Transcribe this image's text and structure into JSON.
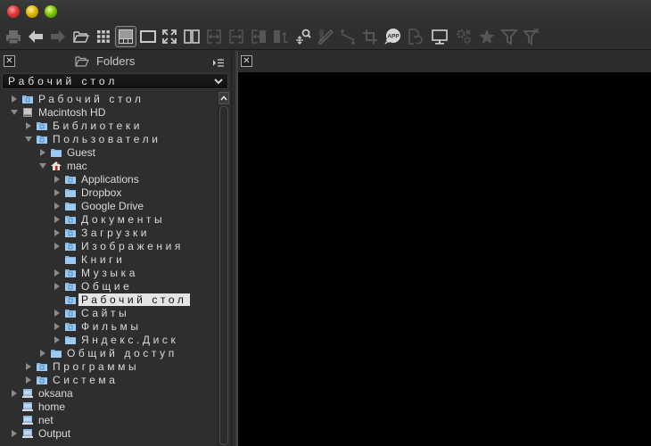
{
  "window": {
    "buttons": [
      "close",
      "minimize",
      "maximize"
    ]
  },
  "toolbar": {
    "items": [
      {
        "name": "print-icon",
        "enabled": false
      },
      {
        "name": "back-arrow-icon",
        "enabled": true
      },
      {
        "name": "forward-arrow-icon",
        "enabled": false
      },
      {
        "name": "open-folder-icon",
        "enabled": true
      },
      {
        "name": "grid-view-icon",
        "enabled": true
      },
      {
        "name": "browser-layout-icon",
        "enabled": true,
        "active": true
      },
      {
        "name": "single-view-icon",
        "enabled": true
      },
      {
        "name": "fullscreen-icon",
        "enabled": true
      },
      {
        "name": "compare-view-icon",
        "enabled": true
      },
      {
        "name": "sync-both-icon",
        "enabled": false
      },
      {
        "name": "sync-right-icon",
        "enabled": false
      },
      {
        "name": "sync-left-icon",
        "enabled": false
      },
      {
        "name": "swap-icon",
        "enabled": false
      },
      {
        "name": "pan-zoom-icon",
        "enabled": true
      },
      {
        "name": "eyedropper-icon",
        "enabled": false
      },
      {
        "name": "straighten-icon",
        "enabled": false
      },
      {
        "name": "crop-icon",
        "enabled": false
      },
      {
        "name": "open-with-app-icon",
        "enabled": true,
        "label": "APP"
      },
      {
        "name": "revert-icon",
        "enabled": false
      },
      {
        "name": "monitor-icon",
        "enabled": true
      },
      {
        "name": "settings-icon",
        "enabled": false
      },
      {
        "name": "star-icon",
        "enabled": false
      },
      {
        "name": "filter-icon",
        "enabled": false
      },
      {
        "name": "clear-filter-icon",
        "enabled": false
      }
    ]
  },
  "folders_panel": {
    "title": "Folders",
    "current_path": "Рабочий стол",
    "tree": [
      {
        "label": "Рабочий стол",
        "level": 0,
        "expander": "collapsed",
        "icon": "desktop-folder",
        "ru": true
      },
      {
        "label": "Macintosh HD",
        "level": 0,
        "expander": "expanded",
        "icon": "hard-drive",
        "ru": false
      },
      {
        "label": "Библиотеки",
        "level": 1,
        "expander": "collapsed",
        "icon": "library-folder",
        "ru": true
      },
      {
        "label": "Пользователи",
        "level": 1,
        "expander": "expanded",
        "icon": "users-folder",
        "ru": true
      },
      {
        "label": "Guest",
        "level": 2,
        "expander": "collapsed",
        "icon": "folder",
        "ru": false
      },
      {
        "label": "mac",
        "level": 2,
        "expander": "expanded",
        "icon": "home",
        "ru": false
      },
      {
        "label": "Applications",
        "level": 3,
        "expander": "collapsed",
        "icon": "apps-folder",
        "ru": false
      },
      {
        "label": "Dropbox",
        "level": 3,
        "expander": "collapsed",
        "icon": "folder",
        "ru": false
      },
      {
        "label": "Google Drive",
        "level": 3,
        "expander": "collapsed",
        "icon": "folder",
        "ru": false
      },
      {
        "label": "Документы",
        "level": 3,
        "expander": "collapsed",
        "icon": "documents-folder",
        "ru": true
      },
      {
        "label": "Загрузки",
        "level": 3,
        "expander": "collapsed",
        "icon": "downloads-folder",
        "ru": true
      },
      {
        "label": "Изображения",
        "level": 3,
        "expander": "collapsed",
        "icon": "pictures-folder",
        "ru": true
      },
      {
        "label": "Книги",
        "level": 3,
        "expander": "none",
        "icon": "folder",
        "ru": true
      },
      {
        "label": "Музыка",
        "level": 3,
        "expander": "collapsed",
        "icon": "music-folder",
        "ru": true
      },
      {
        "label": "Общие",
        "level": 3,
        "expander": "collapsed",
        "icon": "public-folder",
        "ru": true
      },
      {
        "label": "Рабочий стол",
        "level": 3,
        "expander": "none",
        "icon": "desktop-folder",
        "ru": true,
        "selected": true
      },
      {
        "label": "Сайты",
        "level": 3,
        "expander": "collapsed",
        "icon": "sites-folder",
        "ru": true
      },
      {
        "label": "Фильмы",
        "level": 3,
        "expander": "collapsed",
        "icon": "movies-folder",
        "ru": true
      },
      {
        "label": "Яндекс.Диск",
        "level": 3,
        "expander": "collapsed",
        "icon": "folder",
        "ru": true
      },
      {
        "label": "Общий доступ",
        "level": 2,
        "expander": "collapsed",
        "icon": "folder",
        "ru": true
      },
      {
        "label": "Программы",
        "level": 1,
        "expander": "collapsed",
        "icon": "apps-folder",
        "ru": true
      },
      {
        "label": "Система",
        "level": 1,
        "expander": "collapsed",
        "icon": "system-folder",
        "ru": true
      },
      {
        "label": "oksana",
        "level": 0,
        "expander": "collapsed",
        "icon": "network-drive",
        "ru": false
      },
      {
        "label": "home",
        "level": 0,
        "expander": "none",
        "icon": "network-drive",
        "ru": false
      },
      {
        "label": "net",
        "level": 0,
        "expander": "none",
        "icon": "network-drive",
        "ru": false
      },
      {
        "label": "Output",
        "level": 0,
        "expander": "collapsed",
        "icon": "network-drive",
        "ru": false
      }
    ]
  },
  "colors": {
    "folder_blue": "#7fb6e4",
    "selection_bg": "#e4e4e4",
    "background": "#2e2e2e",
    "viewer_bg": "#000000"
  }
}
